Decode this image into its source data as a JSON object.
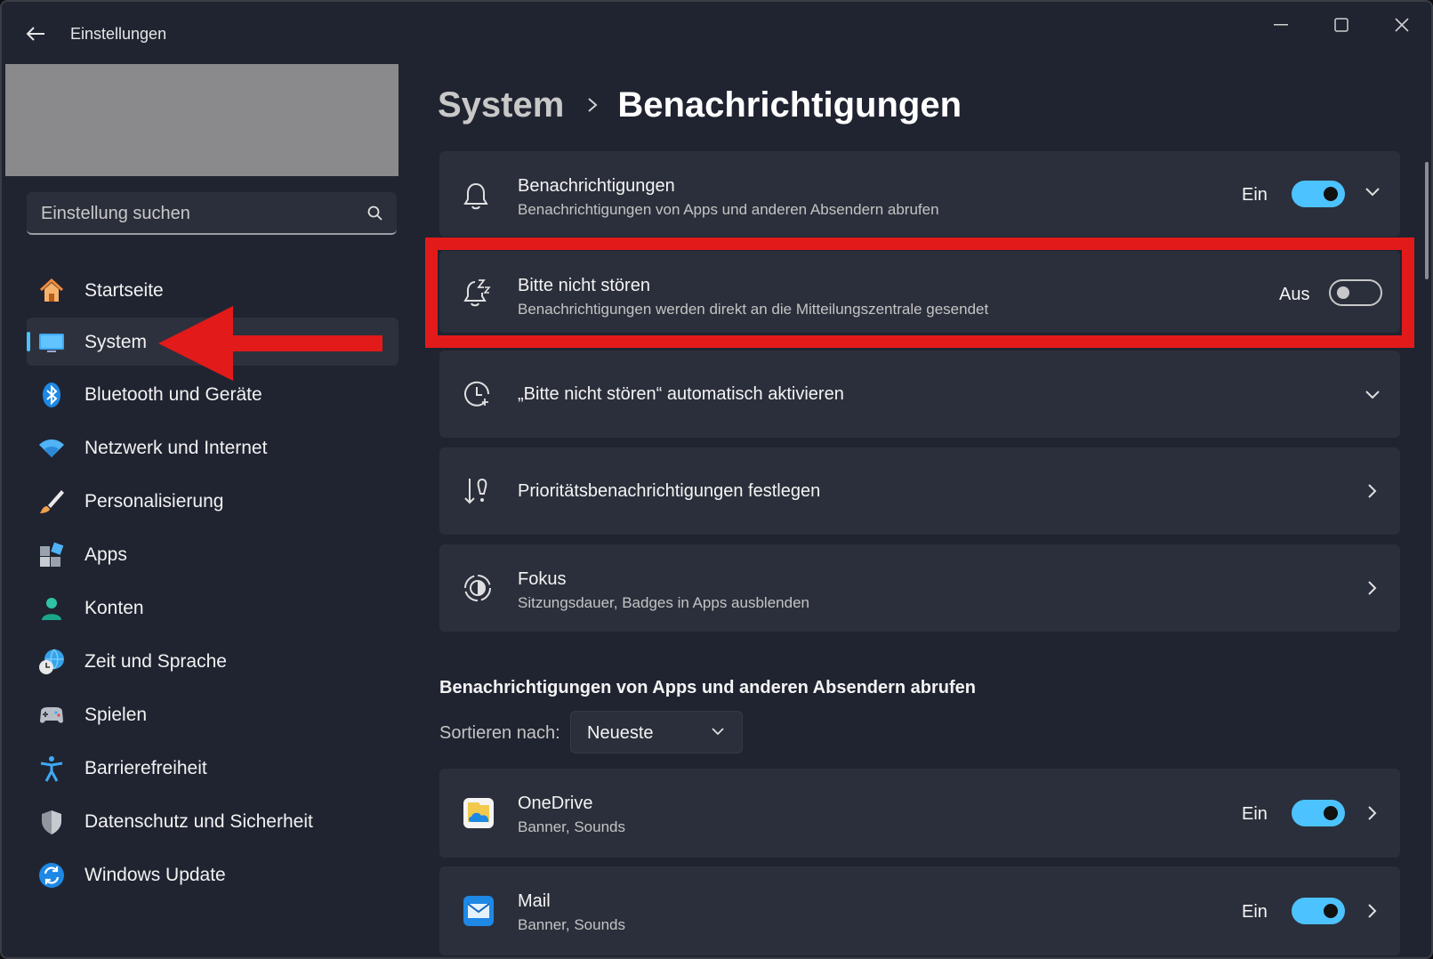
{
  "window": {
    "title": "Einstellungen"
  },
  "search": {
    "placeholder": "Einstellung suchen"
  },
  "sidebar": {
    "items": [
      {
        "label": "Startseite",
        "icon": "home-icon"
      },
      {
        "label": "System",
        "icon": "monitor-icon",
        "active": true
      },
      {
        "label": "Bluetooth und Geräte",
        "icon": "bluetooth-icon"
      },
      {
        "label": "Netzwerk und Internet",
        "icon": "wifi-icon"
      },
      {
        "label": "Personalisierung",
        "icon": "brush-icon"
      },
      {
        "label": "Apps",
        "icon": "apps-icon"
      },
      {
        "label": "Konten",
        "icon": "person-icon"
      },
      {
        "label": "Zeit und Sprache",
        "icon": "globe-clock-icon"
      },
      {
        "label": "Spielen",
        "icon": "gamepad-icon"
      },
      {
        "label": "Barrierefreiheit",
        "icon": "accessibility-icon"
      },
      {
        "label": "Datenschutz und Sicherheit",
        "icon": "shield-icon"
      },
      {
        "label": "Windows Update",
        "icon": "update-icon"
      }
    ]
  },
  "breadcrumb": {
    "parent": "System",
    "current": "Benachrichtigungen"
  },
  "cards": {
    "notifications": {
      "title": "Benachrichtigungen",
      "subtitle": "Benachrichtigungen von Apps und anderen Absendern abrufen",
      "state": "Ein",
      "on": true,
      "icon": "bell-icon"
    },
    "dnd": {
      "title": "Bitte nicht stören",
      "subtitle": "Benachrichtigungen werden direkt an die Mitteilungszentrale gesendet",
      "state": "Aus",
      "on": false,
      "icon": "bell-snooze-icon"
    },
    "auto_dnd": {
      "title": "„Bitte nicht stören“ automatisch aktivieren",
      "icon": "clock-icon"
    },
    "priority": {
      "title": "Prioritätsbenachrichtigungen festlegen",
      "icon": "sort-priority-icon"
    },
    "focus": {
      "title": "Fokus",
      "subtitle": "Sitzungsdauer, Badges in Apps ausblenden",
      "icon": "focus-icon"
    }
  },
  "apps_section": {
    "heading": "Benachrichtigungen von Apps und anderen Absendern abrufen",
    "sort_label": "Sortieren nach:",
    "sort_value": "Neueste",
    "apps": [
      {
        "name": "OneDrive",
        "detail": "Banner, Sounds",
        "state": "Ein",
        "on": true,
        "icon": "onedrive-icon"
      },
      {
        "name": "Mail",
        "detail": "Banner, Sounds",
        "state": "Ein",
        "on": true,
        "icon": "mail-icon"
      }
    ]
  },
  "colors": {
    "accent": "#4cc2ff",
    "highlight": "#e31a1a",
    "background": "#202431",
    "card": "#2b2f3b"
  }
}
